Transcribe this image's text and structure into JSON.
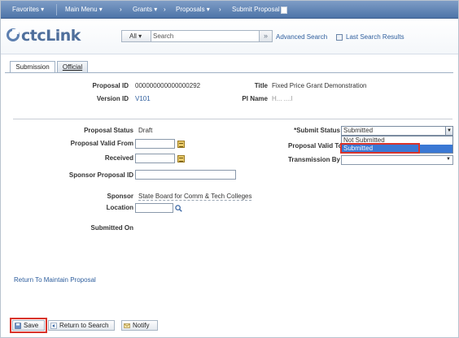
{
  "topnav": {
    "favorites": "Favorites ▾",
    "main_menu": "Main Menu ▾",
    "grants": "Grants ▾",
    "proposals": "Proposals ▾",
    "submit_proposal": "Submit Proposal"
  },
  "header": {
    "logo_text": "ctcLink",
    "search_scope": "All",
    "search_placeholder": "Search",
    "advanced_search": "Advanced Search",
    "last_search_results": "Last Search Results"
  },
  "tabs": [
    {
      "label": "Submission",
      "active": true
    },
    {
      "label": "Official",
      "active": false
    }
  ],
  "proposal": {
    "proposal_id_label": "Proposal ID",
    "proposal_id_value": "000000000000000292",
    "version_id_label": "Version ID",
    "version_id_value": "V101",
    "title_label": "Title",
    "title_value": "Fixed Price Grant Demonstration",
    "pi_name_label": "PI Name",
    "pi_name_value": "H... ....l"
  },
  "form": {
    "proposal_status_label": "Proposal Status",
    "proposal_status_value": "Draft",
    "valid_from_label": "Proposal Valid From",
    "received_label": "Received",
    "sponsor_proposal_id_label": "Sponsor Proposal ID",
    "sponsor_label": "Sponsor",
    "sponsor_value": "State Board for Comm & Tech Colleges",
    "location_label": "Location",
    "submitted_on_label": "Submitted On",
    "submit_status_label": "*Submit Status",
    "submit_status_value": "Submitted",
    "valid_to_label": "Proposal Valid To",
    "transmission_by_label": "Transmission By",
    "submit_status_options": [
      "Not Submitted",
      "Submitted"
    ]
  },
  "links": {
    "return_to_maintain": "Return To Maintain Proposal"
  },
  "buttons": {
    "save": "Save",
    "return_to_search": "Return to Search",
    "notify": "Notify"
  },
  "colors": {
    "nav_bar": "#5a7fb2",
    "link": "#2f5f9e",
    "highlight_box": "#d9342b",
    "selected_option": "#3a78d4"
  }
}
